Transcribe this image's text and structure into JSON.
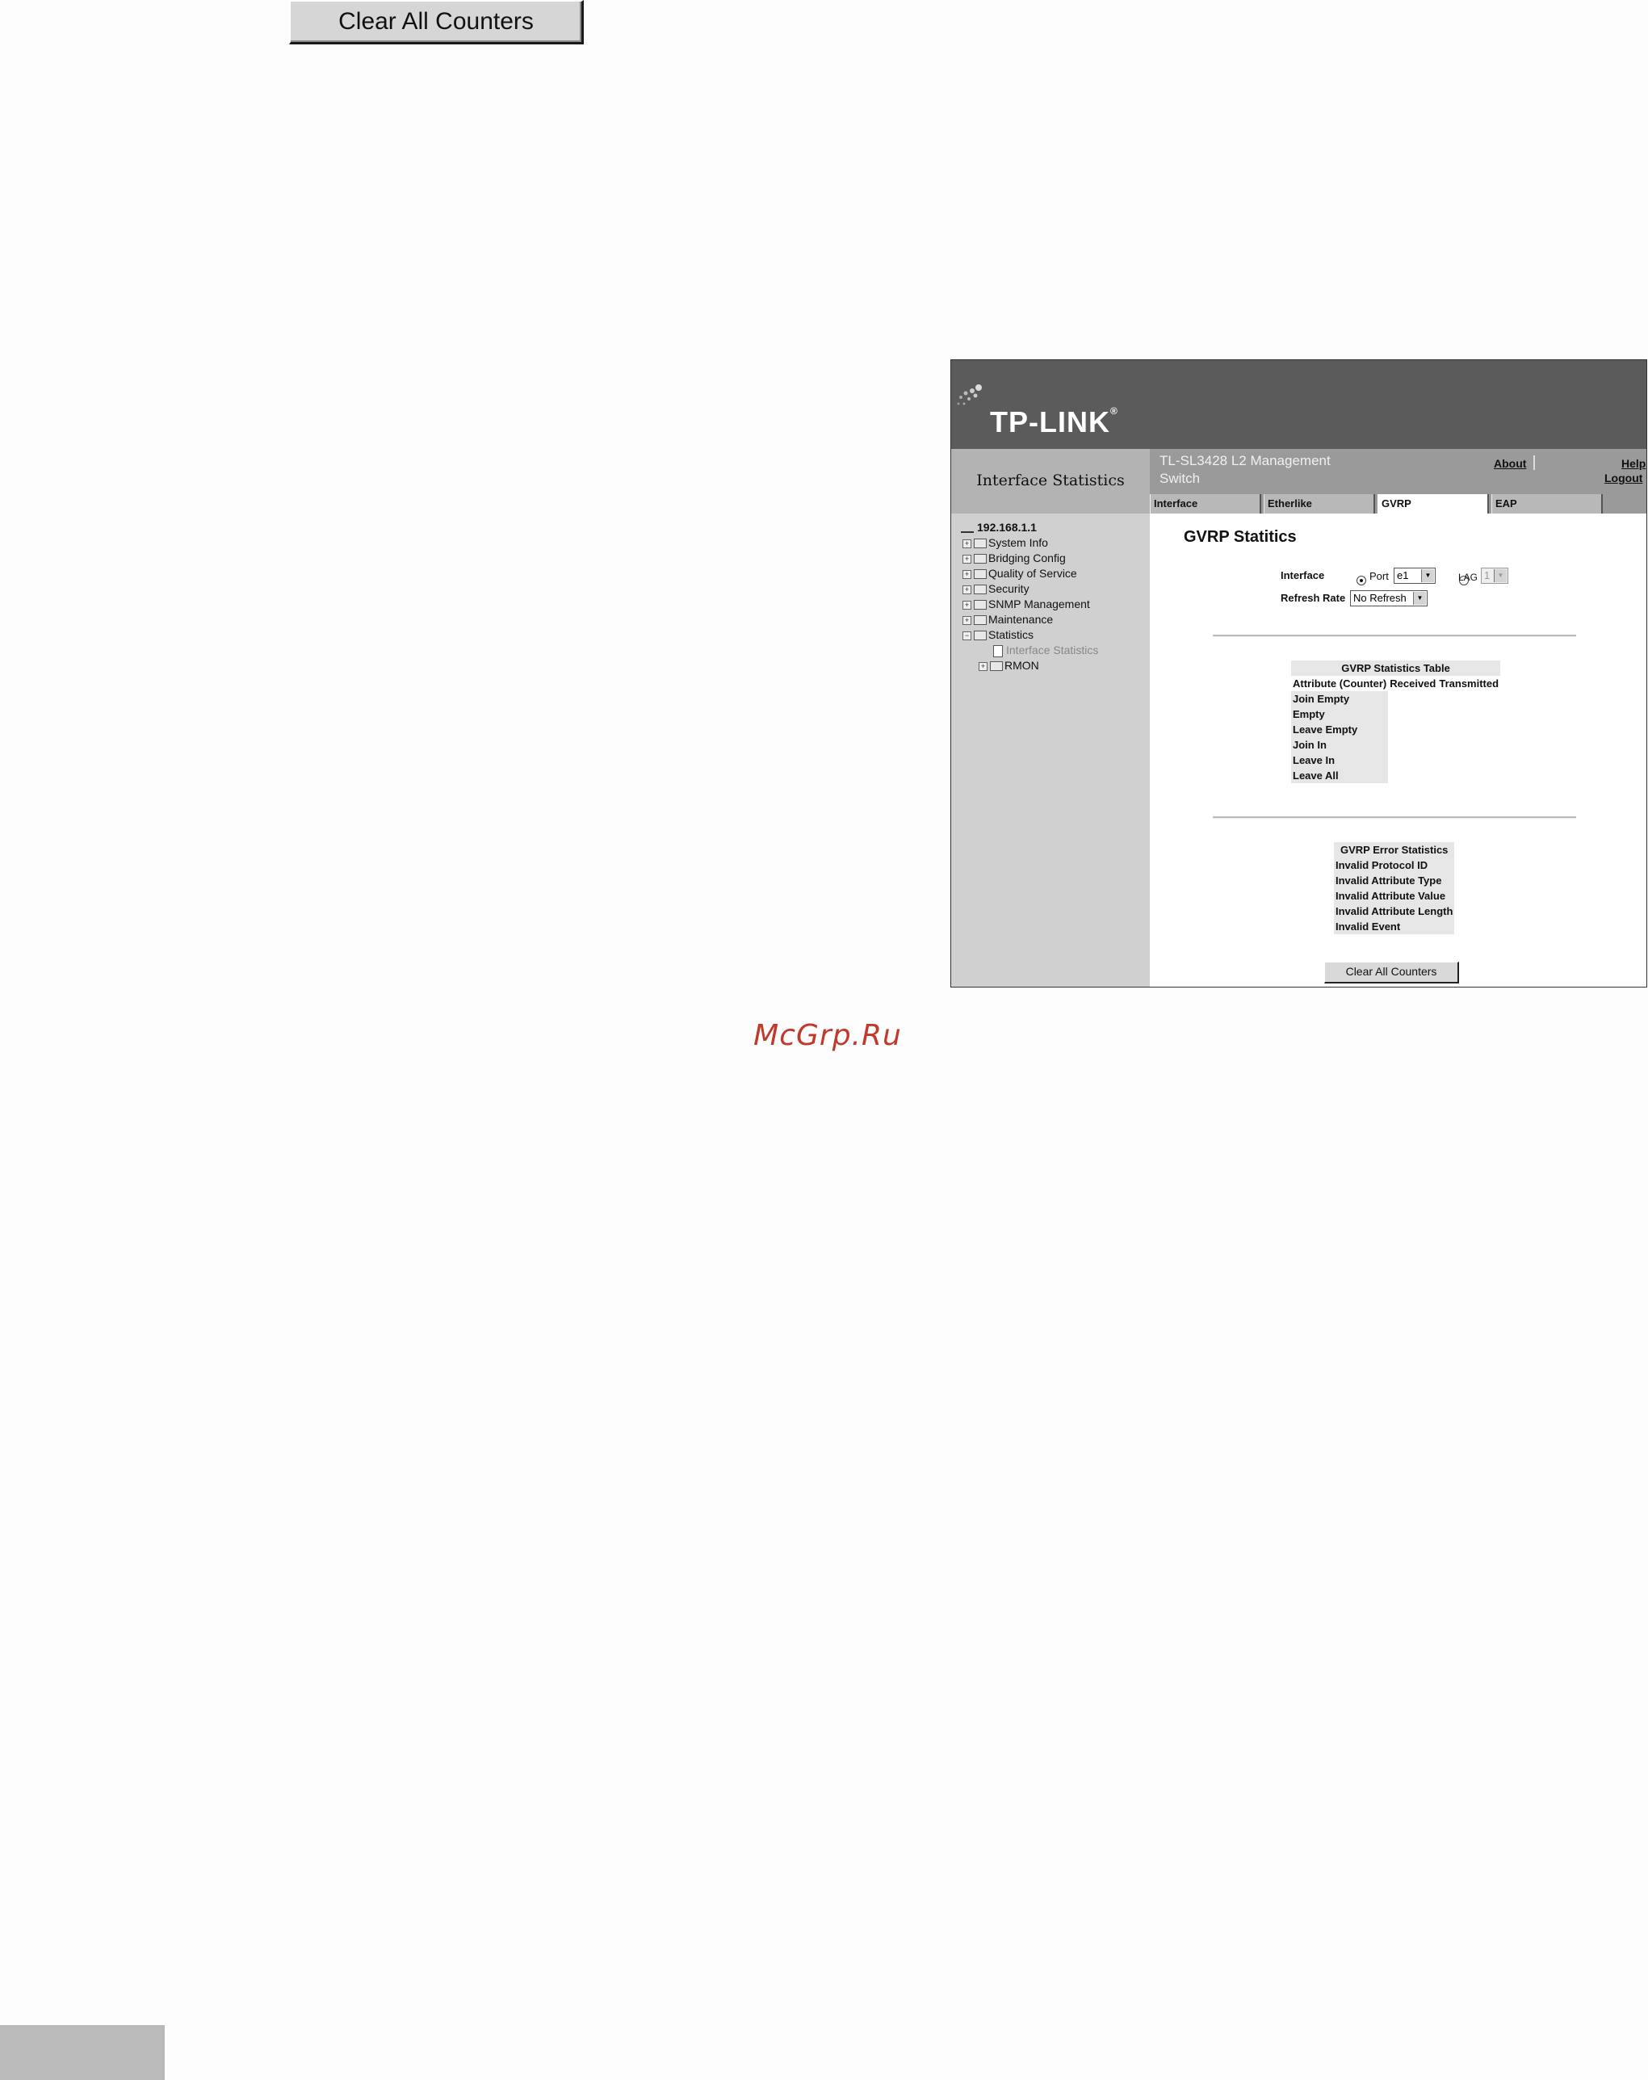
{
  "standalone_button": {
    "label": "Clear All Counters"
  },
  "window": {
    "brand": "TP-LINK",
    "brand_mark": "®",
    "device_name": "TL-SL3428 L2 Management Switch",
    "section_caption": "Interface Statistics",
    "links": {
      "about": "About",
      "help": "Help",
      "logout": "Logout"
    },
    "tabs": [
      {
        "label": "Interface",
        "active": false
      },
      {
        "label": "Etherlike",
        "active": false
      },
      {
        "label": "GVRP",
        "active": true
      },
      {
        "label": "EAP",
        "active": false
      }
    ],
    "tree": {
      "root": "192.168.1.1",
      "items": [
        {
          "label": "System Info",
          "expander": "+"
        },
        {
          "label": "Bridging Config",
          "expander": "+"
        },
        {
          "label": "Quality of Service",
          "expander": "+"
        },
        {
          "label": "Security",
          "expander": "+"
        },
        {
          "label": "SNMP Management",
          "expander": "+"
        },
        {
          "label": "Maintenance",
          "expander": "+"
        },
        {
          "label": "Statistics",
          "expander": "−"
        }
      ],
      "children": [
        {
          "label": "Interface Statistics"
        },
        {
          "label": "RMON",
          "expander": "+"
        }
      ]
    },
    "content": {
      "title": "GVRP Statitics",
      "interface_label": "Interface",
      "port_label": "Port",
      "port_value": "e1",
      "lag_label": "LAG",
      "lag_value": "1",
      "selected_option": "Port",
      "refresh_label": "Refresh Rate",
      "refresh_value": "No Refresh",
      "stats_table": {
        "caption": "GVRP Statistics Table",
        "headers": [
          "Attribute (Counter)",
          "Received",
          "Transmitted"
        ],
        "rows": [
          "Join Empty",
          "Empty",
          "Leave Empty",
          "Join In",
          "Leave In",
          "Leave All"
        ]
      },
      "error_table": {
        "caption": "GVRP Error Statistics",
        "rows": [
          "Invalid Protocol ID",
          "Invalid Attribute Type",
          "Invalid Attribute Value",
          "Invalid Attribute Length",
          "Invalid Event"
        ]
      },
      "clear_button": "Clear All Counters"
    }
  },
  "watermark": "McGrp.Ru"
}
